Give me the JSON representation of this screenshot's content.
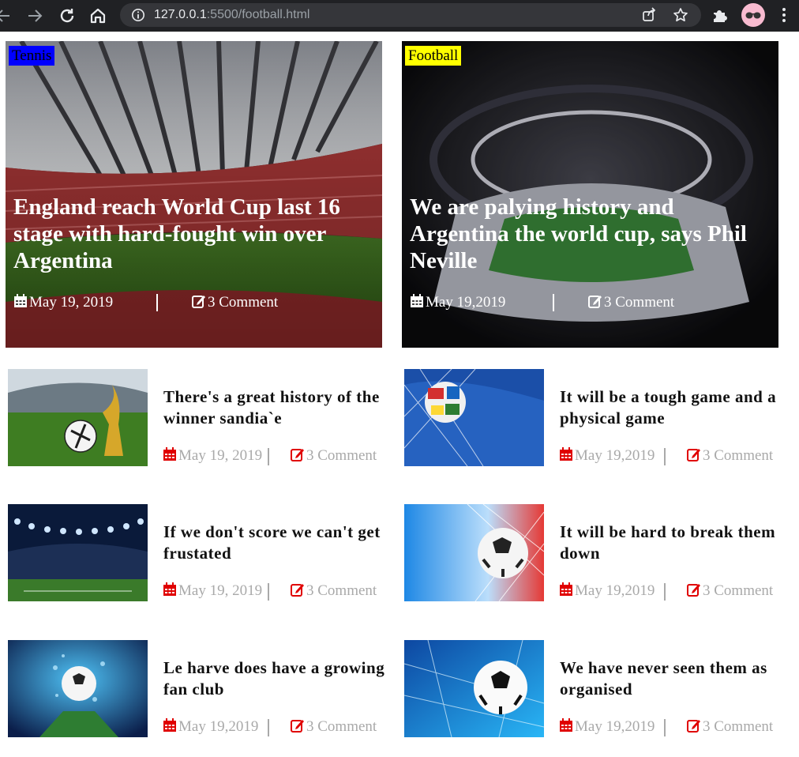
{
  "browser": {
    "url_host": "127.0.0.1",
    "url_path": ":5500/football.html"
  },
  "colors": {
    "accent_red": "#e00000",
    "meta_gray": "#a9a9a9",
    "tag_tennis": "#0000ff",
    "tag_football": "#ffff00"
  },
  "hero": [
    {
      "tag": "Tennis",
      "title": "England reach World Cup last 16 stage with hard-fought win over Argentina",
      "date": "May 19, 2019",
      "comments": "3 Comment"
    },
    {
      "tag": "Football",
      "title": "We are palying history and Argentina the world cup, says Phil Neville",
      "date": "May 19,2019",
      "comments": "3 Comment"
    }
  ],
  "articles": [
    {
      "title": "There's a great history of the winner sandia`e",
      "date": "May 19, 2019",
      "comments": "3 Comment"
    },
    {
      "title": "It will be a tough game and a physical game",
      "date": "May 19,2019",
      "comments": "3 Comment"
    },
    {
      "title": "If we don't score we can't get frustated",
      "date": "May 19, 2019",
      "comments": "3 Comment"
    },
    {
      "title": "It will be hard to break them down",
      "date": "May 19,2019",
      "comments": "3 Comment"
    },
    {
      "title": "Le harve does have a growing fan club",
      "date": "May 19,2019",
      "comments": "3 Comment"
    },
    {
      "title": "We have never seen them as organised",
      "date": "May 19,2019",
      "comments": "3 Comment"
    }
  ]
}
